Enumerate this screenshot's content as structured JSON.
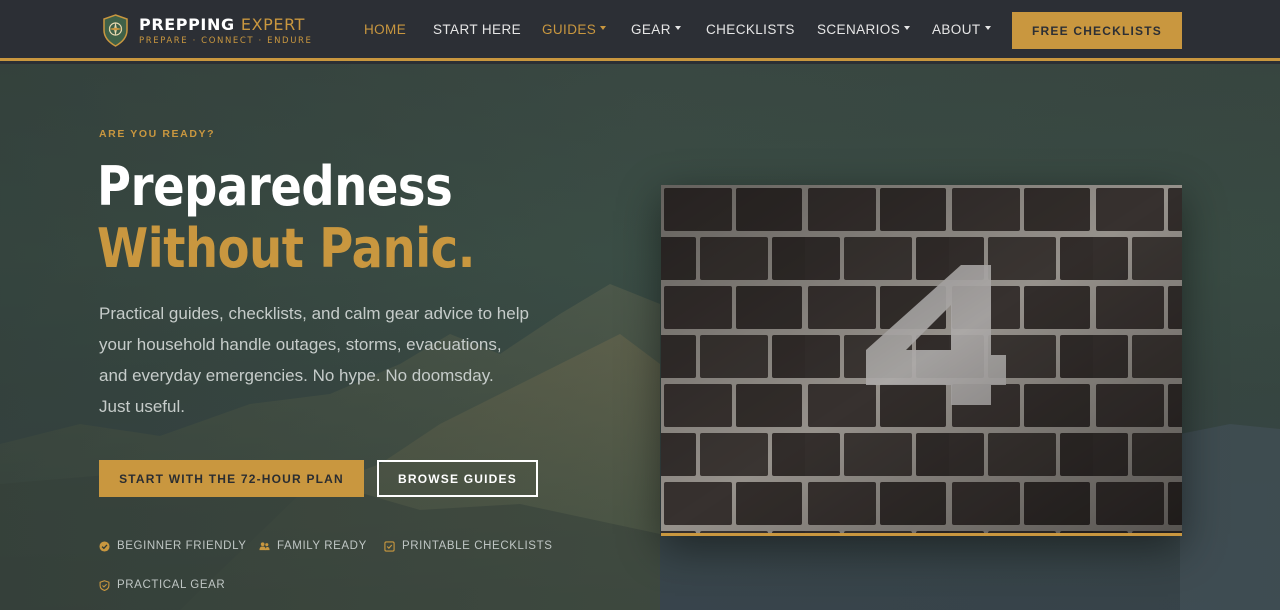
{
  "brand": {
    "name_primary": "PREPPING",
    "name_accent": "EXPERT",
    "tagline": "PREPARE · CONNECT · ENDURE",
    "accent_color": "#c9973f",
    "logo_icon": "compass-shield-icon"
  },
  "nav": {
    "items": [
      {
        "label": "HOME",
        "active": true,
        "dropdown": false
      },
      {
        "label": "START HERE",
        "active": false,
        "dropdown": false
      },
      {
        "label": "GUIDES",
        "active": true,
        "dropdown": true
      },
      {
        "label": "GEAR",
        "active": false,
        "dropdown": true
      },
      {
        "label": "CHECKLISTS",
        "active": false,
        "dropdown": false
      },
      {
        "label": "SCENARIOS",
        "active": false,
        "dropdown": true
      },
      {
        "label": "ABOUT",
        "active": false,
        "dropdown": true
      }
    ],
    "cta": "FREE CHECKLISTS"
  },
  "hero": {
    "eyebrow": "ARE YOU READY?",
    "title_line1": "Preparedness",
    "title_line2": "Without Panic.",
    "lede": "Practical guides, checklists, and calm gear advice to help your household handle outages, storms, evacuations, and everyday emergencies. No hype. No doomsday. Just useful.",
    "primary_button": "START WITH THE 72-HOUR PLAN",
    "secondary_button": "BROWSE GUIDES",
    "features": [
      {
        "label": "BEGINNER FRIENDLY",
        "icon": "check-circle-icon"
      },
      {
        "label": "FAMILY READY",
        "icon": "users-icon"
      },
      {
        "label": "PRINTABLE CHECKLISTS",
        "icon": "clipboard-check-icon"
      },
      {
        "label": "PRACTICAL GEAR",
        "icon": "shield-check-icon"
      }
    ],
    "photo_icon": "brick-wall-number-four-image"
  }
}
